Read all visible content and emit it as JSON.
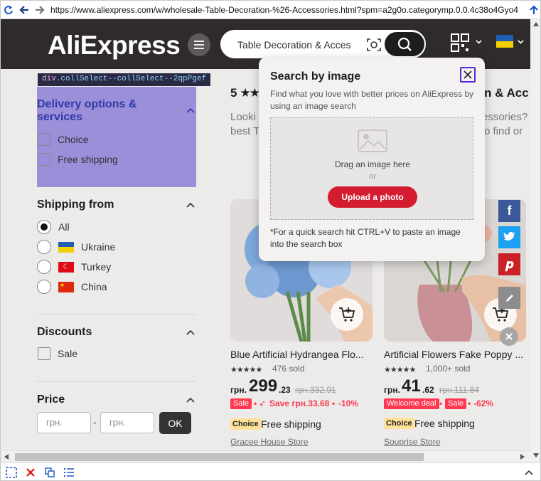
{
  "browser": {
    "url": "https://www.aliexpress.com/w/wholesale-Table-Decoration-%26-Accessories.html?spm=a2g0o.categorymp.0.0.4c38o4Gyo4"
  },
  "header": {
    "logo": "AliExpress",
    "search_value": "Table Decoration & Acces"
  },
  "devtools_tip": {
    "tag": "div",
    "cls": ".collSelect--collSelect--2qpPgef"
  },
  "sidebar": {
    "delivery": {
      "title": "Delivery options & services",
      "options": [
        "Choice",
        "Free shipping"
      ]
    },
    "shipping_from": {
      "title": "Shipping from",
      "options": [
        "All",
        "Ukraine",
        "Turkey",
        "China"
      ],
      "selected": "All"
    },
    "discounts": {
      "title": "Discounts",
      "options": [
        "Sale"
      ]
    },
    "price": {
      "title": "Price",
      "min_placeholder": "грн.",
      "max_placeholder": "грн.",
      "separator": "-",
      "ok_label": "OK"
    }
  },
  "main": {
    "heading_left": "5",
    "heading_right": "n & Acc",
    "desc_left_1": "Looki",
    "desc_left_2": "best T",
    "desc_right_1": "ccessories?",
    "desc_right_2": "o find or"
  },
  "products": [
    {
      "title": "Blue Artificial Hydrangea Flo...",
      "sold": "476 sold",
      "currency": "грн.",
      "price_int": "299",
      "price_dec": ".23",
      "price_old": "грн.332.91",
      "tags": [
        "Sale"
      ],
      "save": "Save грн.33.68",
      "discount": "-10%",
      "choice": "Choice",
      "shipping": "Free shipping",
      "store": "Gracee House Store"
    },
    {
      "title": "Artificial Flowers Fake Poppy ...",
      "sold": "1,000+ sold",
      "currency": "грн.",
      "price_int": "41",
      "price_dec": ".62",
      "price_old": "грн.111.84",
      "tags": [
        "Welcome deal",
        "Sale"
      ],
      "discount": "-62%",
      "choice": "Choice",
      "shipping": "Free shipping",
      "store": "Souprise Store"
    }
  ],
  "popup": {
    "title": "Search by image",
    "subtitle": "Find what you love with better prices on AliExpress by using an image search",
    "drag_text": "Drag an image here",
    "or_text": "or",
    "upload_label": "Upload a photo",
    "note": "*For a quick search hit CTRL+V to paste an image into the search box"
  },
  "colors": {
    "header_bg": "#2f2a2b",
    "accent_red": "#d41c31",
    "highlight": "#9b8fd9",
    "choice_yellow": "#ffe19a"
  }
}
